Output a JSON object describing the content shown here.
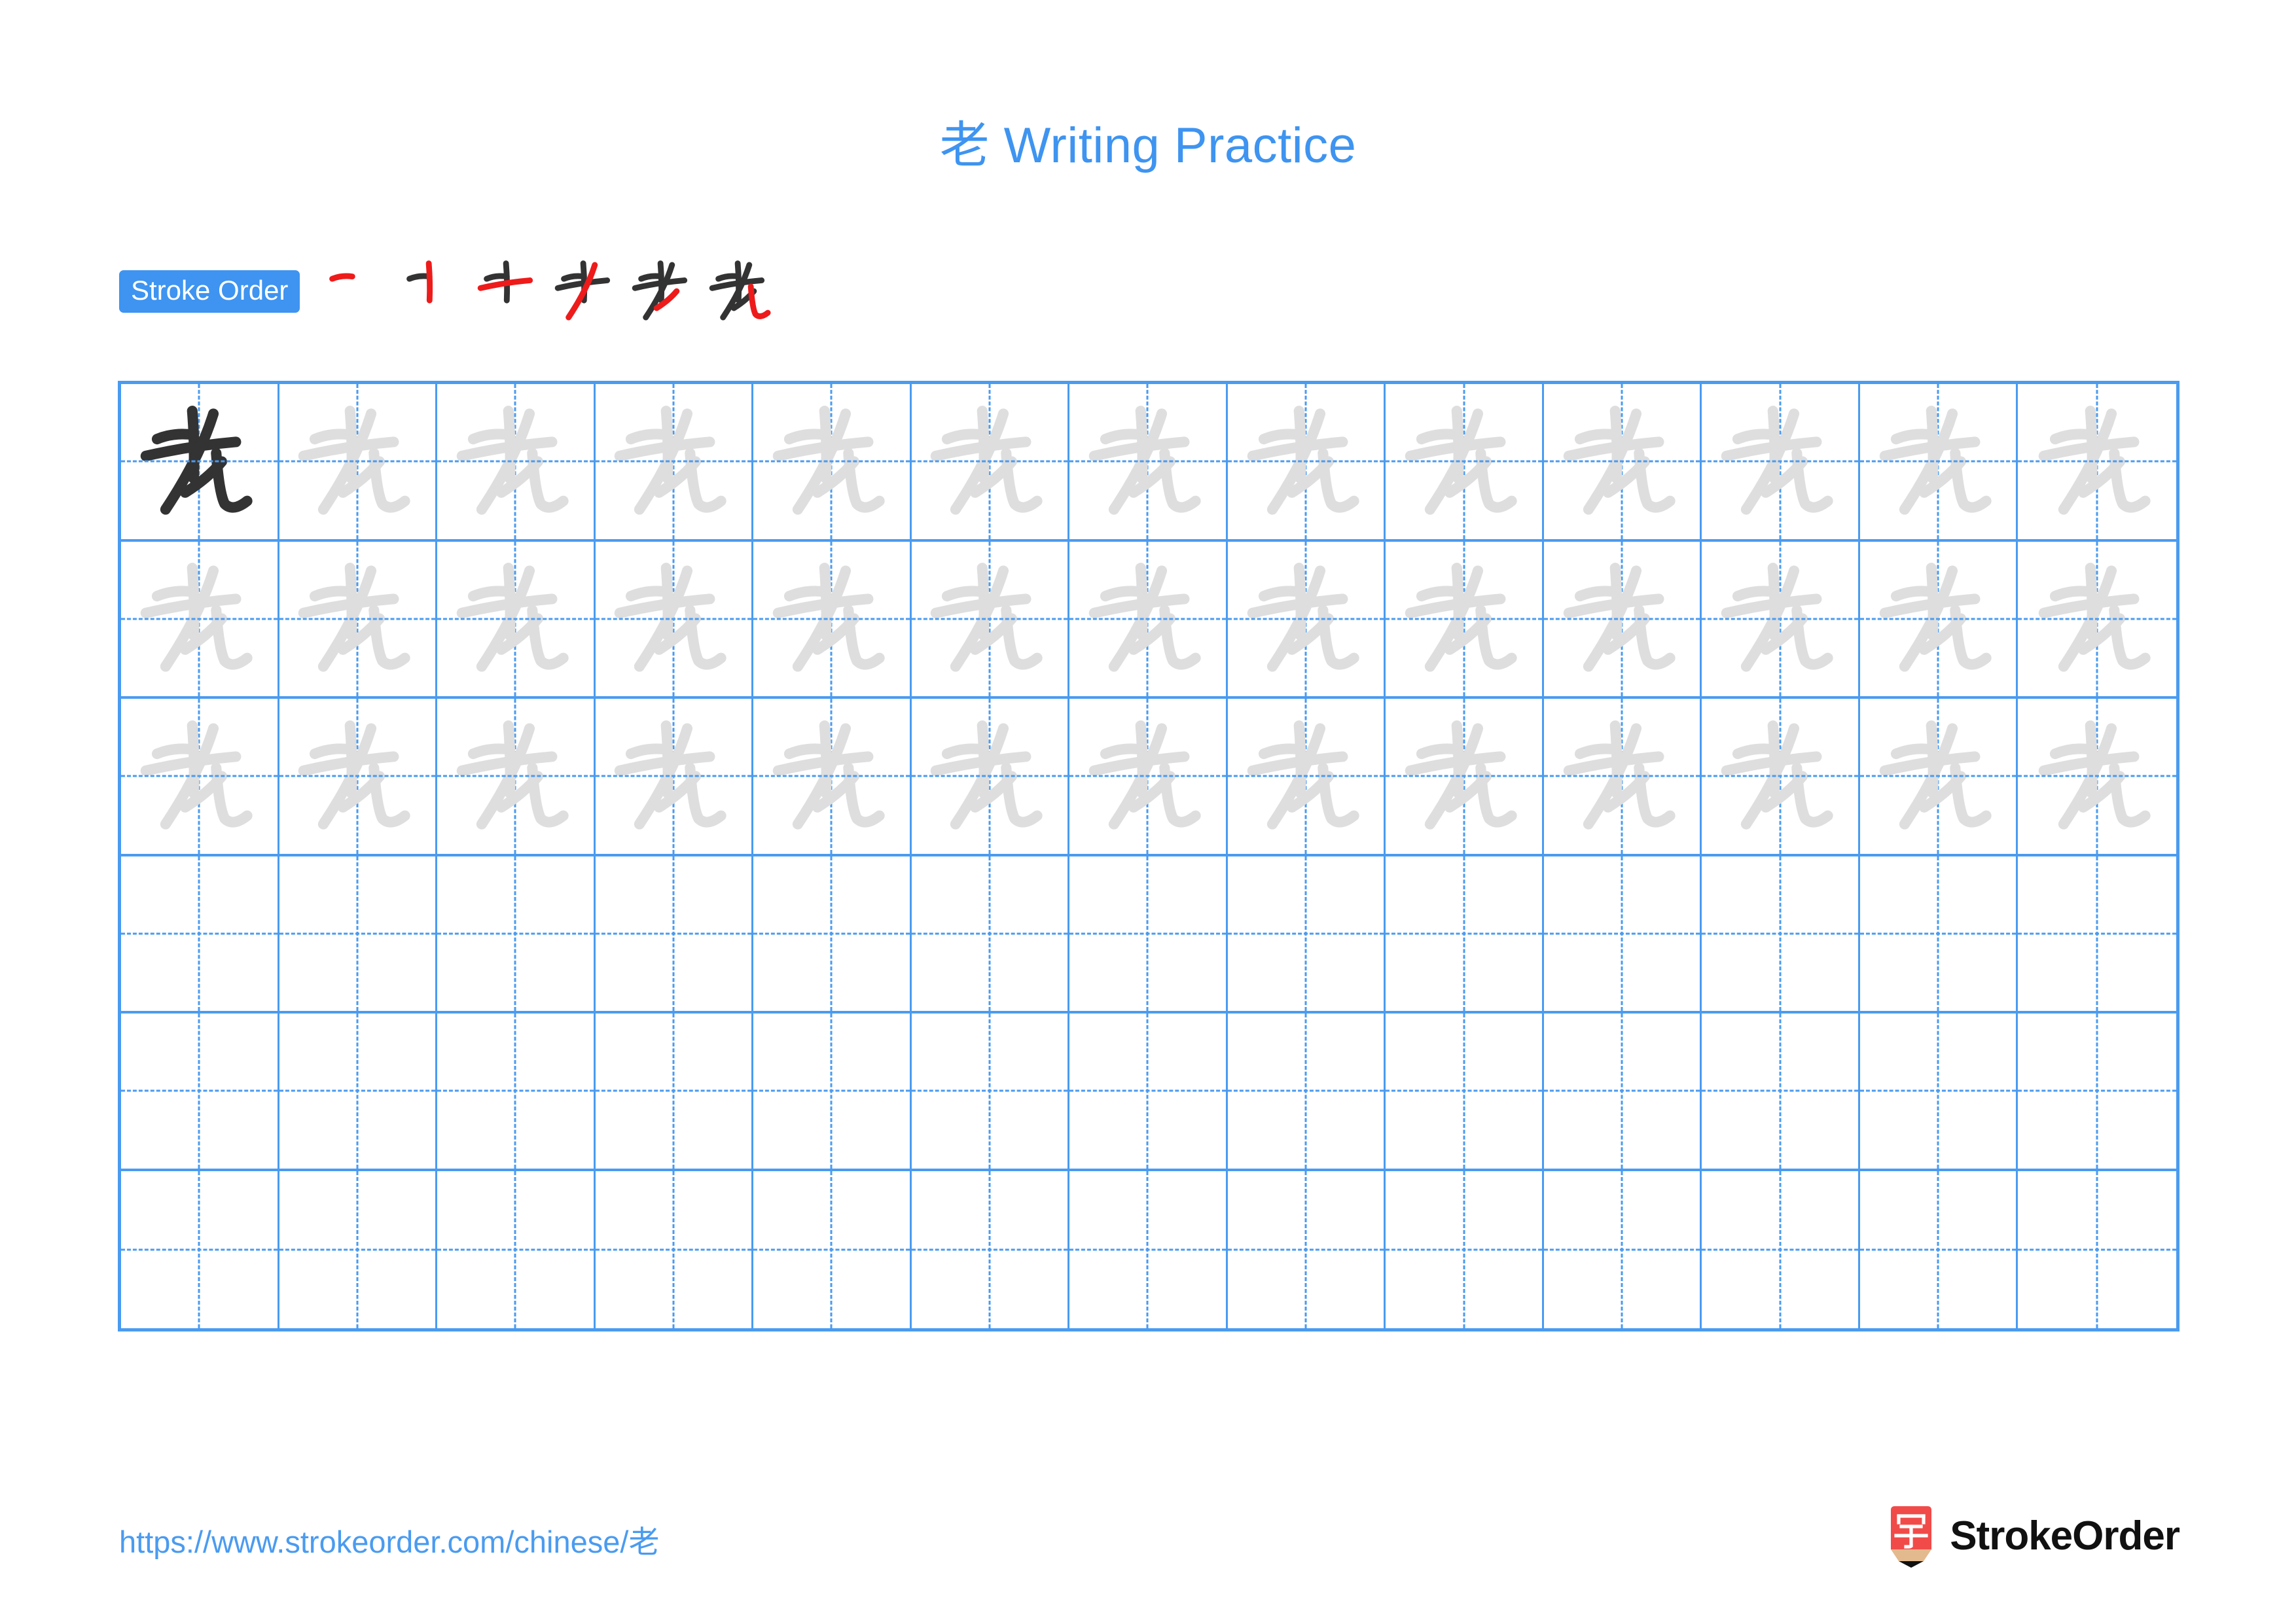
{
  "page": {
    "character": "老",
    "title": "老 Writing Practice",
    "accent_color": "#3E94F0",
    "grid_line_color": "#4A9BF0",
    "trace_color": "#DEDEDE",
    "model_color": "#333333",
    "new_stroke_color": "#EE1B1B"
  },
  "stroke_order": {
    "badge_label": "Stroke Order",
    "total_strokes": 6,
    "steps": [
      {
        "step": 1,
        "strokes_shown": 1,
        "new_stroke": "横 (héng)"
      },
      {
        "step": 2,
        "strokes_shown": 2,
        "new_stroke": "竖 (shù)"
      },
      {
        "step": 3,
        "strokes_shown": 3,
        "new_stroke": "横 (héng)"
      },
      {
        "step": 4,
        "strokes_shown": 4,
        "new_stroke": "撇 (piě)"
      },
      {
        "step": 5,
        "strokes_shown": 5,
        "new_stroke": "撇 (piě)"
      },
      {
        "step": 6,
        "strokes_shown": 6,
        "new_stroke": "竖弯钩 (shùwāngōu)"
      }
    ]
  },
  "practice_grid": {
    "columns": 13,
    "rows": 6,
    "model_cell": {
      "row": 1,
      "column": 1
    },
    "row_fill": [
      "traced",
      "traced",
      "traced",
      "empty",
      "empty",
      "empty"
    ],
    "cell_character": "老"
  },
  "footer": {
    "url": "https://www.strokeorder.com/chinese/老",
    "brand": "StrokeOrder",
    "logo_character": "字"
  }
}
